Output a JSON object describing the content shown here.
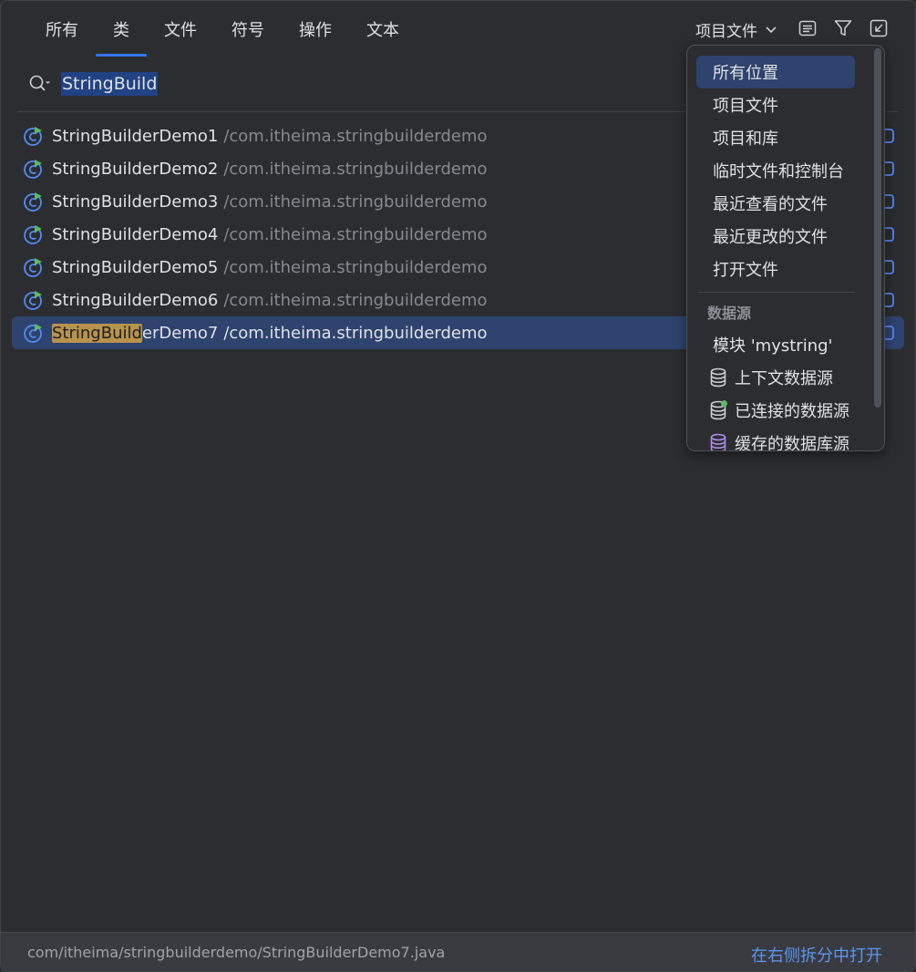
{
  "tabs": [
    {
      "label": "所有"
    },
    {
      "label": "类"
    },
    {
      "label": "文件"
    },
    {
      "label": "符号"
    },
    {
      "label": "操作"
    },
    {
      "label": "文本"
    }
  ],
  "active_tab": "类",
  "scope": {
    "label": "项目文件"
  },
  "toolbar": {
    "icons": [
      "preview-icon",
      "filter-icon",
      "collapse-icon"
    ]
  },
  "search": {
    "value": "StringBuild"
  },
  "results": [
    {
      "name": "StringBuilderDemo1",
      "path": "/com.itheima.stringbuilderdemo"
    },
    {
      "name": "StringBuilderDemo2",
      "path": "/com.itheima.stringbuilderdemo"
    },
    {
      "name": "StringBuilderDemo3",
      "path": "/com.itheima.stringbuilderdemo"
    },
    {
      "name": "StringBuilderDemo4",
      "path": "/com.itheima.stringbuilderdemo"
    },
    {
      "name": "StringBuilderDemo5",
      "path": "/com.itheima.stringbuilderdemo"
    },
    {
      "name": "StringBuilderDemo6",
      "path": "/com.itheima.stringbuilderdemo"
    },
    {
      "name_match": "StringBuild",
      "name_rest": "erDemo7",
      "path": "/com.itheima.stringbuilderdemo"
    }
  ],
  "dropdown": {
    "items": [
      {
        "label": "所有位置"
      },
      {
        "label": "项目文件"
      },
      {
        "label": "项目和库"
      },
      {
        "label": "临时文件和控制台"
      },
      {
        "label": "最近查看的文件"
      },
      {
        "label": "最近更改的文件"
      },
      {
        "label": "打开文件"
      }
    ],
    "group_label": "数据源",
    "group_items": [
      {
        "label": "模块 'mystring'"
      },
      {
        "label": "上下文数据源",
        "icon": "database-icon"
      },
      {
        "label": "已连接的数据源",
        "icon": "database-connected-icon"
      },
      {
        "label": "缓存的数据库源",
        "icon": "database-cached-icon"
      }
    ]
  },
  "status": {
    "path": "com/itheima/stringbuilderdemo/StringBuilderDemo7.java",
    "open_right_label": "在右侧拆分中打开"
  },
  "colors": {
    "accent": "#3574f0",
    "selection": "#2e436e",
    "match_highlight": "#b8934b",
    "link": "#5c95f0"
  }
}
